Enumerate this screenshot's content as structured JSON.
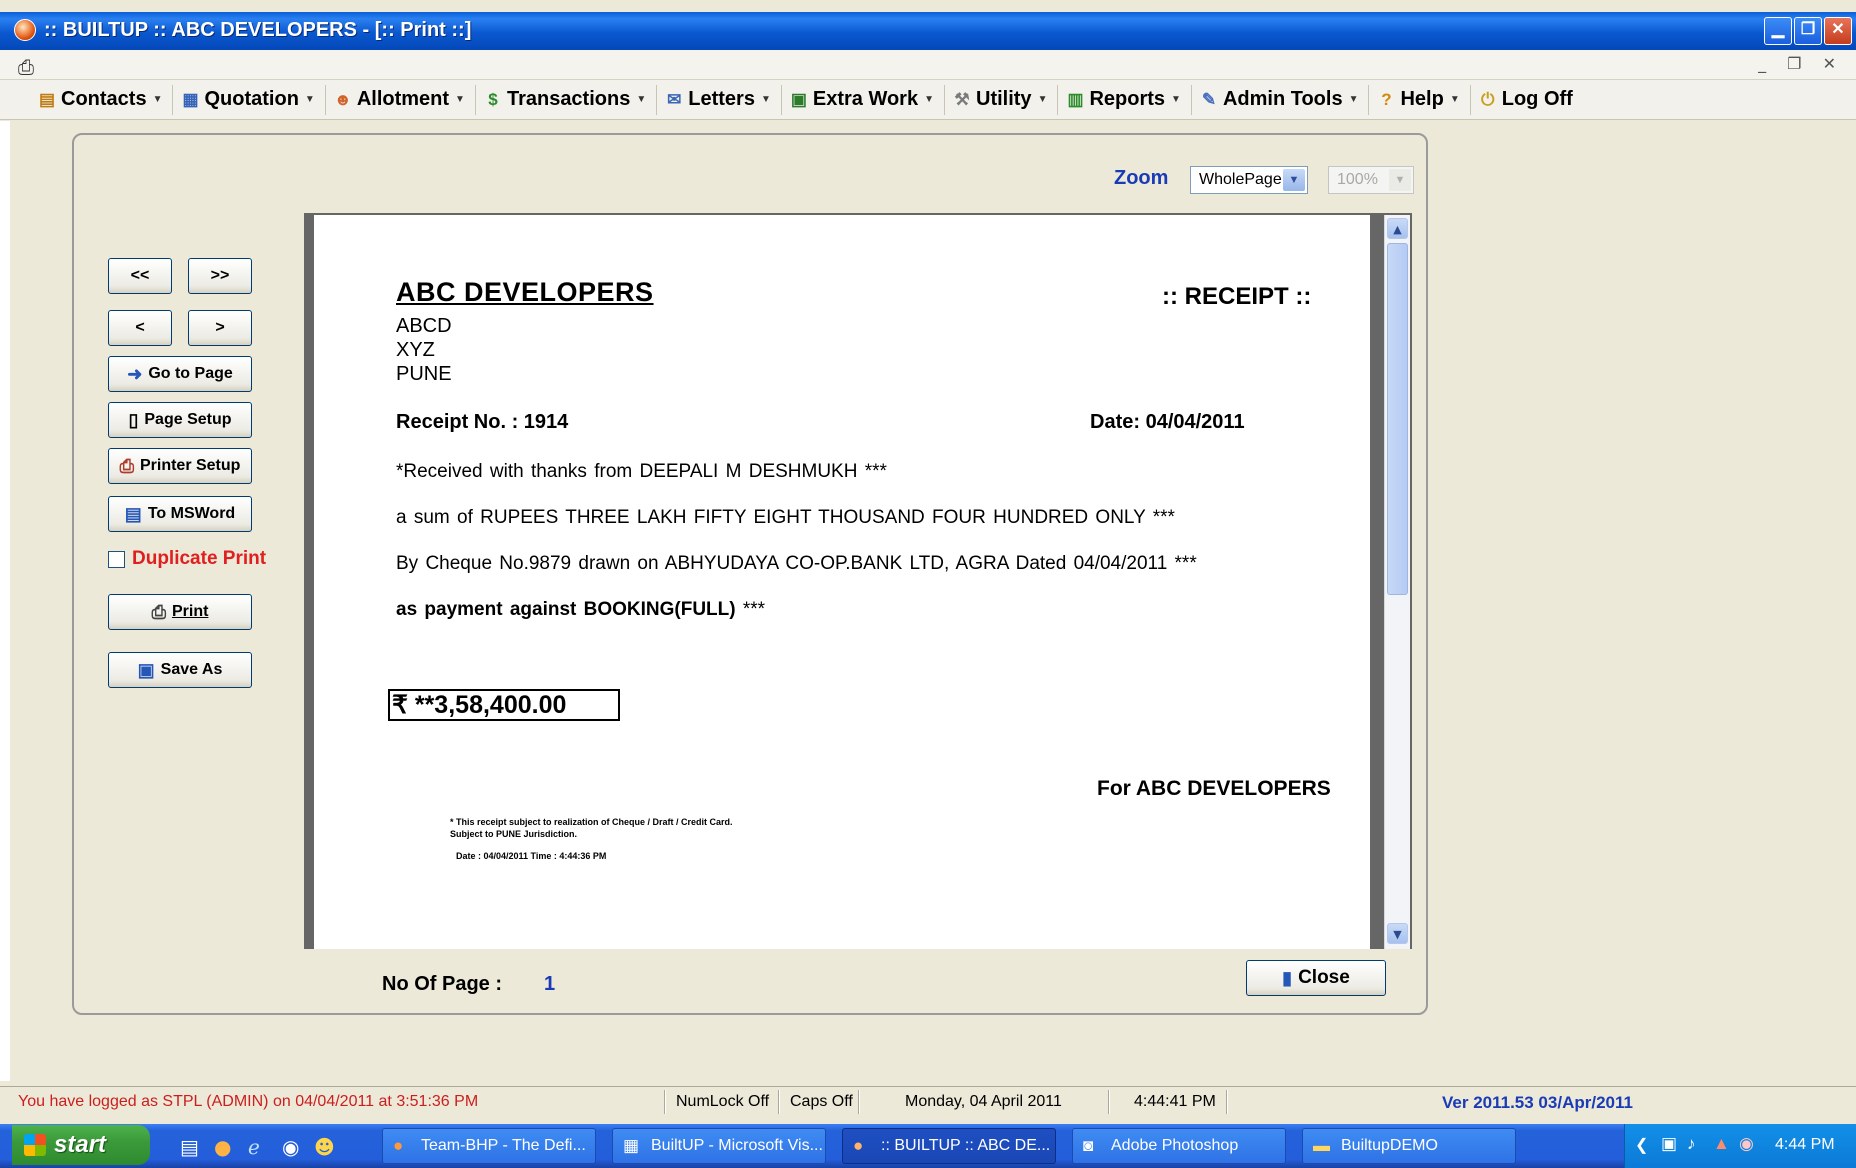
{
  "window": {
    "title": ":: BUILTUP :: ABC DEVELOPERS - [:: Print ::]",
    "controls": [
      "minimize",
      "restore",
      "close"
    ]
  },
  "menu": {
    "items": [
      {
        "label": "Contacts",
        "icon": "contacts-icon",
        "dropdown": true
      },
      {
        "label": "Quotation",
        "icon": "document-icon",
        "dropdown": true
      },
      {
        "label": "Allotment",
        "icon": "people-icon",
        "dropdown": true
      },
      {
        "label": "Transactions",
        "icon": "money-icon",
        "dropdown": true
      },
      {
        "label": "Letters",
        "icon": "letter-icon",
        "dropdown": true
      },
      {
        "label": "Extra Work",
        "icon": "extra-work-icon",
        "dropdown": true
      },
      {
        "label": "Utility",
        "icon": "tools-icon",
        "dropdown": true
      },
      {
        "label": "Reports",
        "icon": "reports-icon",
        "dropdown": true
      },
      {
        "label": "Admin Tools",
        "icon": "admin-tools-icon",
        "dropdown": true
      },
      {
        "label": "Help",
        "icon": "help-icon",
        "dropdown": true
      },
      {
        "label": "Log Off",
        "icon": "log-off-icon",
        "dropdown": false
      }
    ]
  },
  "preview": {
    "zoom_label": "Zoom",
    "zoom_value": "WholePage",
    "percent_value": "100%",
    "nav": {
      "first": "<<",
      "last": ">>",
      "prev": "<",
      "next": ">"
    },
    "buttons": {
      "goto_page": "Go to Page",
      "page_setup": "Page Setup",
      "printer_setup": "Printer Setup",
      "to_msword": "To MSWord",
      "duplicate_print": "Duplicate Print",
      "print": "Print",
      "save_as": "Save As",
      "close": "Close"
    },
    "no_of_page_label": "No Of Page :",
    "no_of_page_value": "1"
  },
  "receipt": {
    "company": "ABC DEVELOPERS",
    "heading": ":: RECEIPT ::",
    "address": [
      "ABCD",
      "XYZ",
      "PUNE"
    ],
    "receipt_no": "Receipt No. : 1914",
    "date": "Date: 04/04/2011",
    "line1": "*Received with thanks from  DEEPALI M DESHMUKH ***",
    "line2": "a sum of RUPEES   THREE LAKH FIFTY  EIGHT  THOUSAND  FOUR  HUNDRED  ONLY ***",
    "line3": "By Cheque No.9879 drawn on ABHYUDAYA CO-OP.BANK LTD, AGRA Dated 04/04/2011 ***",
    "line4_bold": "as payment against BOOKING(FULL)",
    "line4_tail": " ***",
    "amount": "₹ **3,58,400.00",
    "for_company": "For ABC DEVELOPERS",
    "footnote1": "* This receipt subject to realization of Cheque / Draft / Credit Card.",
    "footnote2": "Subject to PUNE Jurisdiction.",
    "footnote3": "Date : 04/04/2011    Time : 4:44:36 PM"
  },
  "status": {
    "login": "You have logged as STPL (ADMIN) on 04/04/2011 at 3:51:36 PM",
    "numlock": "NumLock Off",
    "caps": "Caps Off",
    "date": "Monday, 04 April 2011",
    "time": "4:44:41 PM",
    "version": "Ver 2011.53 03/Apr/2011"
  },
  "taskbar": {
    "start": "start",
    "tasks": [
      {
        "label": "Team-BHP - The Defi...",
        "icon": "firefox-icon"
      },
      {
        "label": "BuiltUP - Microsoft Vis...",
        "icon": "visual-studio-icon"
      },
      {
        "label": ":: BUILTUP :: ABC DE...",
        "icon": "builtup-icon",
        "active": true
      },
      {
        "label": "Adobe Photoshop",
        "icon": "photoshop-icon"
      },
      {
        "label": "BuiltupDEMO",
        "icon": "folder-icon"
      }
    ],
    "clock": "4:44 PM"
  },
  "colors": {
    "title_blue": "#0a58d0",
    "accent_link_blue": "#1a3bb6",
    "duplicate_red": "#e02020",
    "status_login_red": "#cc1e1e",
    "taskbar_blue": "#245edb",
    "start_green": "#3c9a3c"
  }
}
